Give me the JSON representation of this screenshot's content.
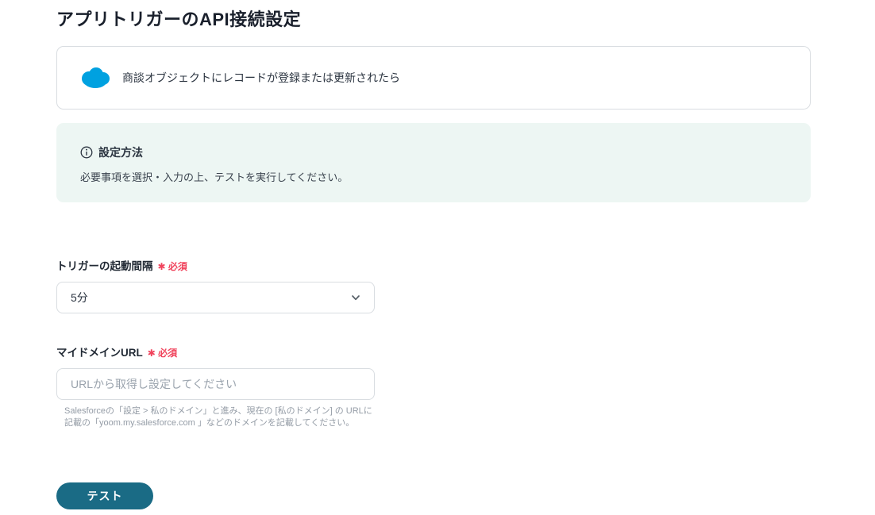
{
  "page": {
    "title": "アプリトリガーのAPI接続設定"
  },
  "trigger_card": {
    "icon": "salesforce-cloud-icon",
    "icon_color": "#00A1E0",
    "text": "商談オブジェクトにレコードが登録または更新されたら"
  },
  "info_box": {
    "icon": "info-circle-icon",
    "title": "設定方法",
    "body": "必要事項を選択・入力の上、テストを実行してください。",
    "background_color": "#edf6f3"
  },
  "form": {
    "required_mark": "✱ 必須",
    "required_color": "#f0435c",
    "interval_field": {
      "label": "トリガーの起動間隔",
      "selected_value": "5分"
    },
    "domain_field": {
      "label": "マイドメインURL",
      "placeholder": "URLから取得し設定してください",
      "help_line1": "Salesforceの「設定 > 私のドメイン」と進み、現在の [私のドメイン] の URLに",
      "help_line2": "記載の「yoom.my.salesforce.com 」などのドメインを記載してください。"
    },
    "test_button": {
      "label": "テスト",
      "color": "#1a6b85"
    }
  }
}
